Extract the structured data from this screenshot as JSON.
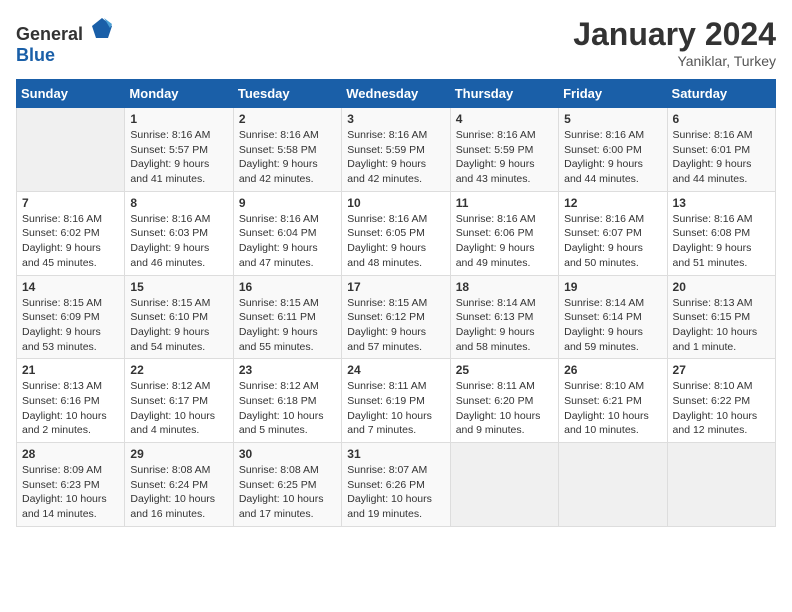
{
  "header": {
    "logo": {
      "general": "General",
      "blue": "Blue"
    },
    "title": "January 2024",
    "subtitle": "Yaniklar, Turkey"
  },
  "columns": [
    "Sunday",
    "Monday",
    "Tuesday",
    "Wednesday",
    "Thursday",
    "Friday",
    "Saturday"
  ],
  "weeks": [
    [
      {
        "day": null,
        "sunrise": null,
        "sunset": null,
        "daylight": null
      },
      {
        "day": "1",
        "sunrise": "Sunrise: 8:16 AM",
        "sunset": "Sunset: 5:57 PM",
        "daylight": "Daylight: 9 hours and 41 minutes."
      },
      {
        "day": "2",
        "sunrise": "Sunrise: 8:16 AM",
        "sunset": "Sunset: 5:58 PM",
        "daylight": "Daylight: 9 hours and 42 minutes."
      },
      {
        "day": "3",
        "sunrise": "Sunrise: 8:16 AM",
        "sunset": "Sunset: 5:59 PM",
        "daylight": "Daylight: 9 hours and 42 minutes."
      },
      {
        "day": "4",
        "sunrise": "Sunrise: 8:16 AM",
        "sunset": "Sunset: 5:59 PM",
        "daylight": "Daylight: 9 hours and 43 minutes."
      },
      {
        "day": "5",
        "sunrise": "Sunrise: 8:16 AM",
        "sunset": "Sunset: 6:00 PM",
        "daylight": "Daylight: 9 hours and 44 minutes."
      },
      {
        "day": "6",
        "sunrise": "Sunrise: 8:16 AM",
        "sunset": "Sunset: 6:01 PM",
        "daylight": "Daylight: 9 hours and 44 minutes."
      }
    ],
    [
      {
        "day": "7",
        "sunrise": "Sunrise: 8:16 AM",
        "sunset": "Sunset: 6:02 PM",
        "daylight": "Daylight: 9 hours and 45 minutes."
      },
      {
        "day": "8",
        "sunrise": "Sunrise: 8:16 AM",
        "sunset": "Sunset: 6:03 PM",
        "daylight": "Daylight: 9 hours and 46 minutes."
      },
      {
        "day": "9",
        "sunrise": "Sunrise: 8:16 AM",
        "sunset": "Sunset: 6:04 PM",
        "daylight": "Daylight: 9 hours and 47 minutes."
      },
      {
        "day": "10",
        "sunrise": "Sunrise: 8:16 AM",
        "sunset": "Sunset: 6:05 PM",
        "daylight": "Daylight: 9 hours and 48 minutes."
      },
      {
        "day": "11",
        "sunrise": "Sunrise: 8:16 AM",
        "sunset": "Sunset: 6:06 PM",
        "daylight": "Daylight: 9 hours and 49 minutes."
      },
      {
        "day": "12",
        "sunrise": "Sunrise: 8:16 AM",
        "sunset": "Sunset: 6:07 PM",
        "daylight": "Daylight: 9 hours and 50 minutes."
      },
      {
        "day": "13",
        "sunrise": "Sunrise: 8:16 AM",
        "sunset": "Sunset: 6:08 PM",
        "daylight": "Daylight: 9 hours and 51 minutes."
      }
    ],
    [
      {
        "day": "14",
        "sunrise": "Sunrise: 8:15 AM",
        "sunset": "Sunset: 6:09 PM",
        "daylight": "Daylight: 9 hours and 53 minutes."
      },
      {
        "day": "15",
        "sunrise": "Sunrise: 8:15 AM",
        "sunset": "Sunset: 6:10 PM",
        "daylight": "Daylight: 9 hours and 54 minutes."
      },
      {
        "day": "16",
        "sunrise": "Sunrise: 8:15 AM",
        "sunset": "Sunset: 6:11 PM",
        "daylight": "Daylight: 9 hours and 55 minutes."
      },
      {
        "day": "17",
        "sunrise": "Sunrise: 8:15 AM",
        "sunset": "Sunset: 6:12 PM",
        "daylight": "Daylight: 9 hours and 57 minutes."
      },
      {
        "day": "18",
        "sunrise": "Sunrise: 8:14 AM",
        "sunset": "Sunset: 6:13 PM",
        "daylight": "Daylight: 9 hours and 58 minutes."
      },
      {
        "day": "19",
        "sunrise": "Sunrise: 8:14 AM",
        "sunset": "Sunset: 6:14 PM",
        "daylight": "Daylight: 9 hours and 59 minutes."
      },
      {
        "day": "20",
        "sunrise": "Sunrise: 8:13 AM",
        "sunset": "Sunset: 6:15 PM",
        "daylight": "Daylight: 10 hours and 1 minute."
      }
    ],
    [
      {
        "day": "21",
        "sunrise": "Sunrise: 8:13 AM",
        "sunset": "Sunset: 6:16 PM",
        "daylight": "Daylight: 10 hours and 2 minutes."
      },
      {
        "day": "22",
        "sunrise": "Sunrise: 8:12 AM",
        "sunset": "Sunset: 6:17 PM",
        "daylight": "Daylight: 10 hours and 4 minutes."
      },
      {
        "day": "23",
        "sunrise": "Sunrise: 8:12 AM",
        "sunset": "Sunset: 6:18 PM",
        "daylight": "Daylight: 10 hours and 5 minutes."
      },
      {
        "day": "24",
        "sunrise": "Sunrise: 8:11 AM",
        "sunset": "Sunset: 6:19 PM",
        "daylight": "Daylight: 10 hours and 7 minutes."
      },
      {
        "day": "25",
        "sunrise": "Sunrise: 8:11 AM",
        "sunset": "Sunset: 6:20 PM",
        "daylight": "Daylight: 10 hours and 9 minutes."
      },
      {
        "day": "26",
        "sunrise": "Sunrise: 8:10 AM",
        "sunset": "Sunset: 6:21 PM",
        "daylight": "Daylight: 10 hours and 10 minutes."
      },
      {
        "day": "27",
        "sunrise": "Sunrise: 8:10 AM",
        "sunset": "Sunset: 6:22 PM",
        "daylight": "Daylight: 10 hours and 12 minutes."
      }
    ],
    [
      {
        "day": "28",
        "sunrise": "Sunrise: 8:09 AM",
        "sunset": "Sunset: 6:23 PM",
        "daylight": "Daylight: 10 hours and 14 minutes."
      },
      {
        "day": "29",
        "sunrise": "Sunrise: 8:08 AM",
        "sunset": "Sunset: 6:24 PM",
        "daylight": "Daylight: 10 hours and 16 minutes."
      },
      {
        "day": "30",
        "sunrise": "Sunrise: 8:08 AM",
        "sunset": "Sunset: 6:25 PM",
        "daylight": "Daylight: 10 hours and 17 minutes."
      },
      {
        "day": "31",
        "sunrise": "Sunrise: 8:07 AM",
        "sunset": "Sunset: 6:26 PM",
        "daylight": "Daylight: 10 hours and 19 minutes."
      },
      {
        "day": null,
        "sunrise": null,
        "sunset": null,
        "daylight": null
      },
      {
        "day": null,
        "sunrise": null,
        "sunset": null,
        "daylight": null
      },
      {
        "day": null,
        "sunrise": null,
        "sunset": null,
        "daylight": null
      }
    ]
  ]
}
